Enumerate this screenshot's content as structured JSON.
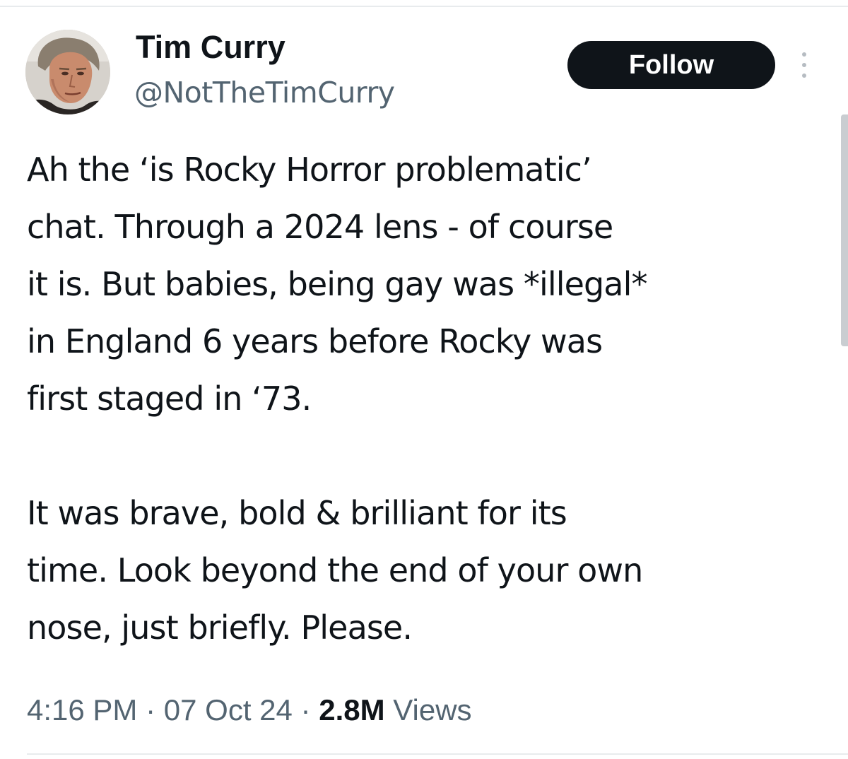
{
  "author": {
    "name": "Tim Curry",
    "handle": "@NotTheTimCurry",
    "avatar_icon": "profile-photo"
  },
  "follow_label": "Follow",
  "more_icon": "more-dots-icon",
  "tweet": {
    "paragraph1_lines": [
      "Ah the ‘is Rocky Horror problematic’",
      "chat. Through a 2024 lens - of course",
      "it is. But babies, being gay was *illegal*",
      "in England 6 years before Rocky was",
      "first staged in ‘73."
    ],
    "paragraph2_lines": [
      "It was brave, bold & brilliant for its",
      "time. Look beyond the end of your own",
      "nose, just briefly. Please."
    ]
  },
  "meta": {
    "time": "4:16 PM",
    "separator": "·",
    "date": "07 Oct 24",
    "views_count": "2.8M",
    "views_label": "Views"
  },
  "colors": {
    "text": "#0f1419",
    "secondary": "#536471",
    "follow_bg": "#0f1419",
    "follow_text": "#ffffff"
  }
}
